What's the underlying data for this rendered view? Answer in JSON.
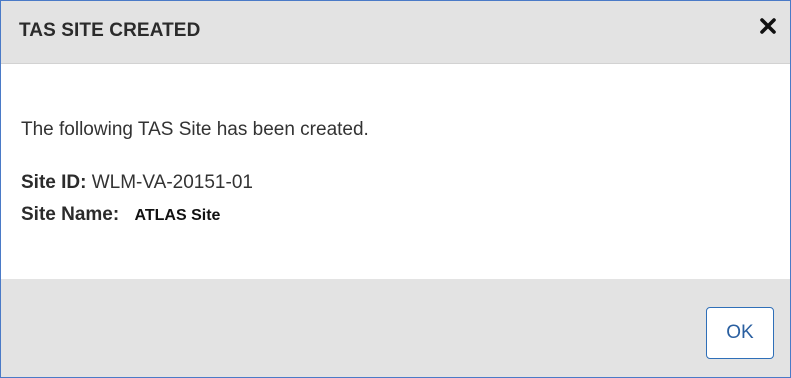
{
  "dialog": {
    "title": "TAS SITE CREATED",
    "close_icon": "close-icon",
    "message": "The following TAS Site has been created.",
    "site_id_label": "Site ID:",
    "site_id_value": "WLM-VA-20151-01",
    "site_name_label": "Site Name:",
    "site_name_value": "ATLAS Site",
    "ok_label": "OK"
  },
  "colors": {
    "header_bg": "#e3e3e3",
    "border": "#4a7ac7",
    "button_border": "#2f6fb8",
    "button_text": "#2a5fa0"
  }
}
